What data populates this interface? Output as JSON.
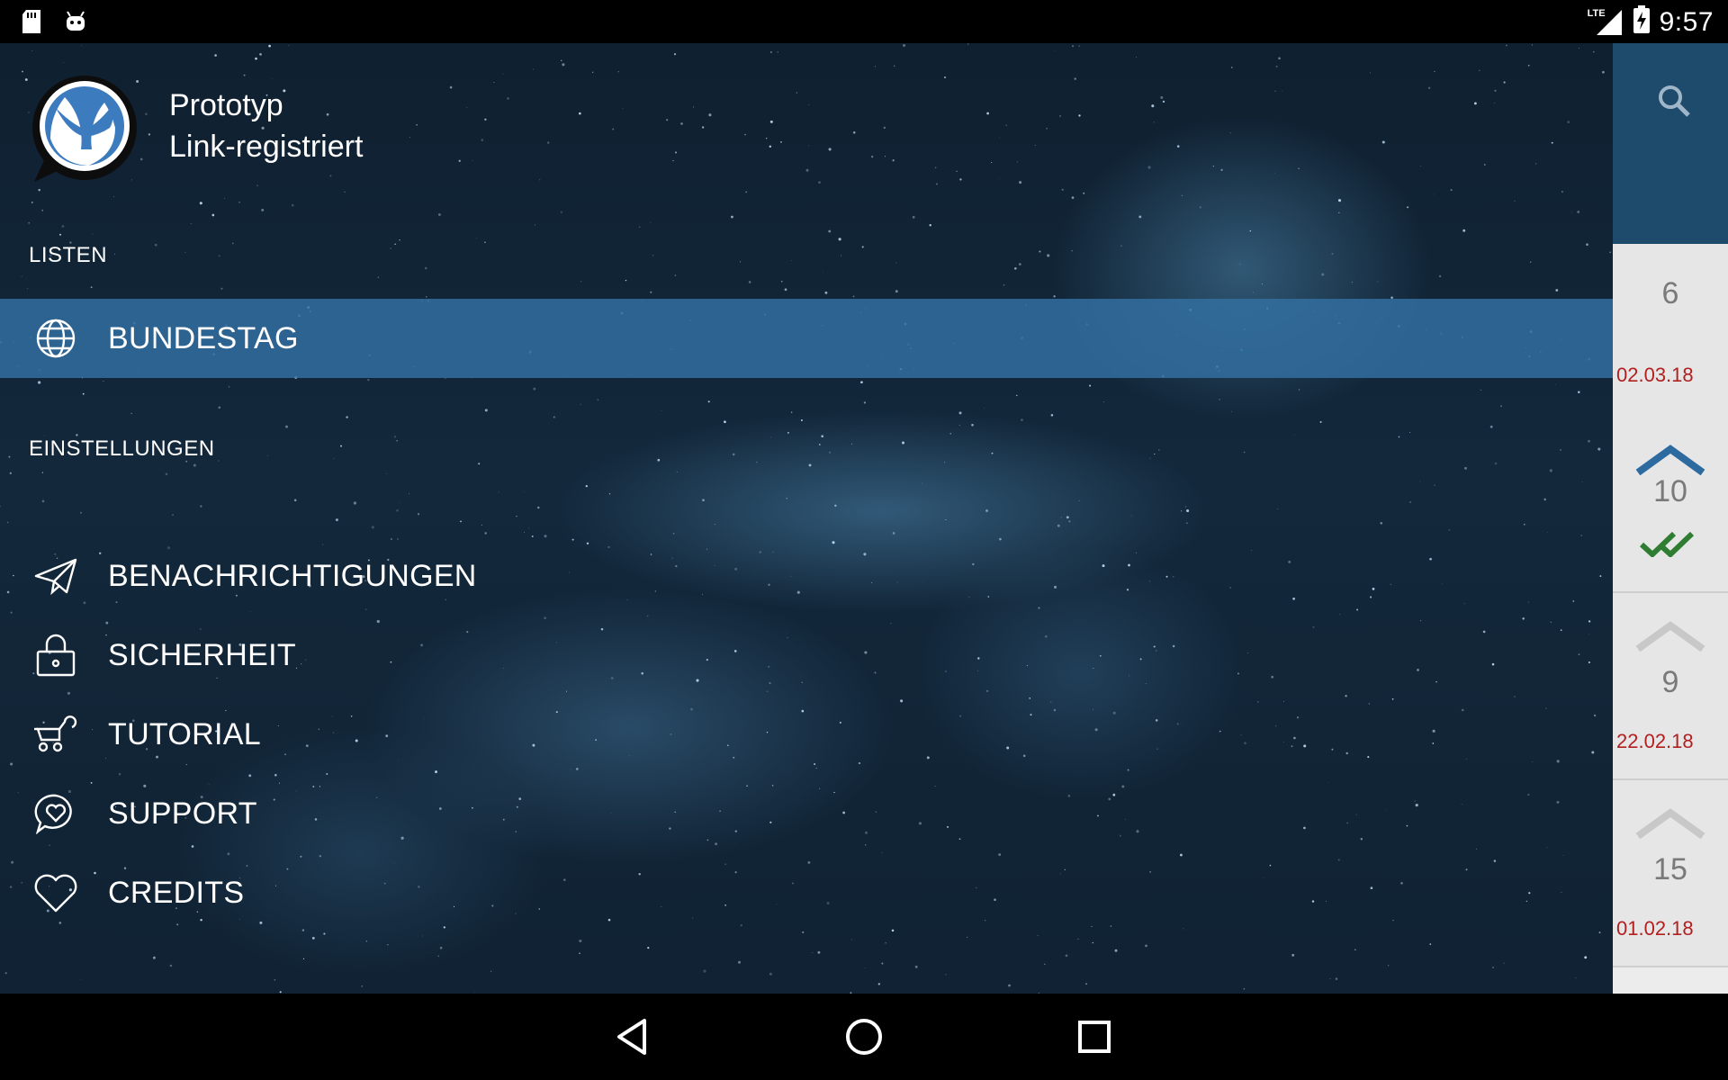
{
  "status_bar": {
    "left_icons": [
      "sd-card-icon",
      "android-icon"
    ],
    "network_label": "LTE",
    "time": "9:57"
  },
  "drawer": {
    "account": {
      "name": "Prototyp",
      "status": "Link-registriert"
    },
    "sections": {
      "lists_header": "LISTEN",
      "settings_header": "EINSTELLUNGEN"
    },
    "lists": [
      {
        "label": "BUNDESTAG",
        "icon": "globe-icon",
        "active": true
      }
    ],
    "settings": [
      {
        "label": "BENACHRICHTIGUNGEN",
        "icon": "paper-plane-icon"
      },
      {
        "label": "SICHERHEIT",
        "icon": "lock-icon"
      },
      {
        "label": "TUTORIAL",
        "icon": "baby-stroller-icon"
      },
      {
        "label": "SUPPORT",
        "icon": "heart-chat-icon"
      },
      {
        "label": "CREDITS",
        "icon": "heart-icon"
      }
    ]
  },
  "background_list": {
    "search_icon": "search-icon",
    "cards": [
      {
        "count": "6",
        "date": "02.03.18"
      },
      {
        "count": "10",
        "date": ""
      },
      {
        "count": "9",
        "date": "22.02.18"
      },
      {
        "count": "15",
        "date": "01.02.18"
      }
    ]
  },
  "colors": {
    "accent": "#1e4a6c",
    "active_item": "#2f6a9a",
    "date_red": "#b22020",
    "check_green": "#2e7d32"
  },
  "nav_bar": {
    "buttons": [
      "back-icon",
      "home-icon",
      "recents-icon"
    ]
  }
}
